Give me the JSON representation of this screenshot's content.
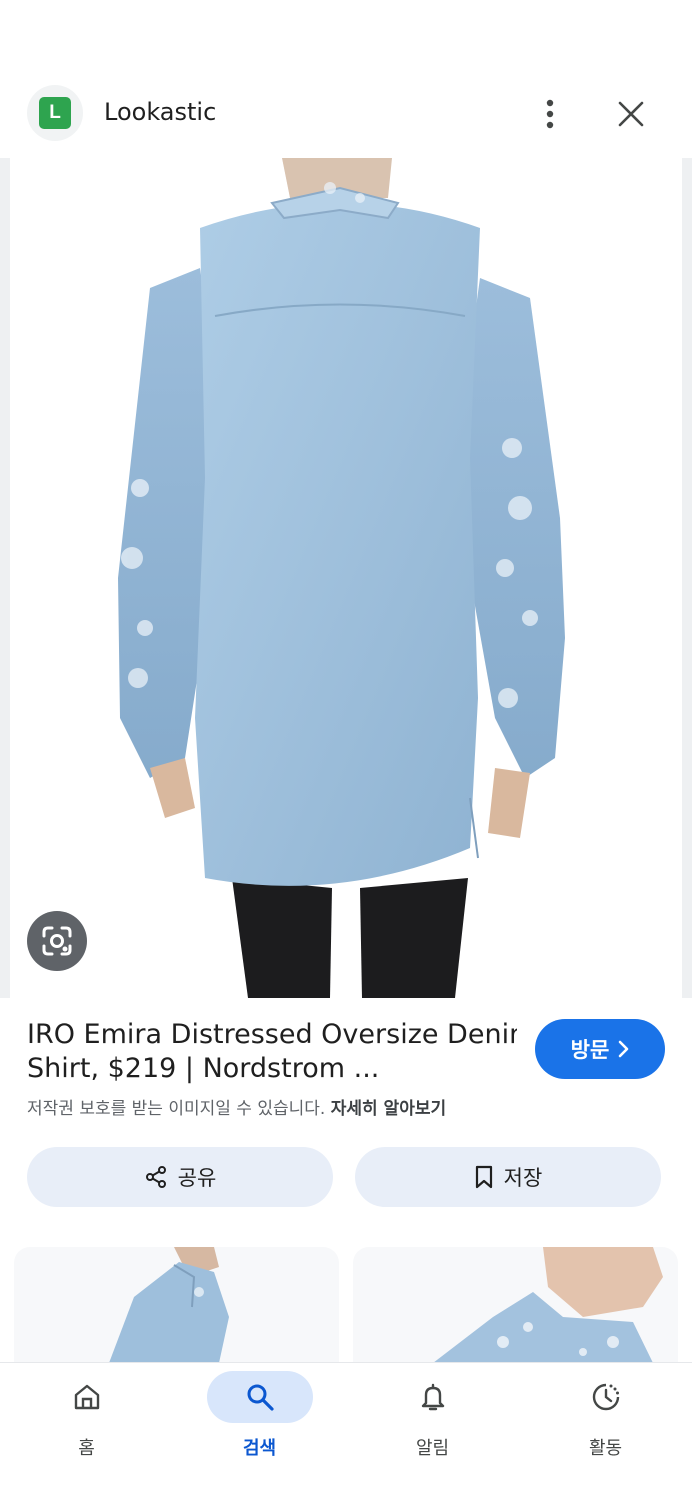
{
  "header": {
    "favicon_letter": "L",
    "site_name": "Lookastic",
    "icons": {
      "more": "more-vert-icon",
      "close": "close-icon"
    }
  },
  "result": {
    "title_line1": "IRO Emira Distressed Oversize Denim",
    "title_line2": "Shirt, $219 | Nordstrom ...",
    "visit_label": "방문",
    "notice_text": "저작권 보호를 받는 이미지일 수 있습니다.",
    "notice_link": "자세히 알아보기"
  },
  "actions": {
    "share_label": "공유",
    "save_label": "저장"
  },
  "bottom_nav": {
    "items": [
      {
        "label": "홈",
        "icon": "home-icon",
        "active": false
      },
      {
        "label": "검색",
        "icon": "search-icon",
        "active": true
      },
      {
        "label": "알림",
        "icon": "bell-icon",
        "active": false
      },
      {
        "label": "활동",
        "icon": "history-icon",
        "active": false
      }
    ]
  },
  "colors": {
    "accent": "#1a73e8",
    "favicon": "#2ea44f",
    "pill_bg": "#e8eef8",
    "nav_active_bg": "#d8e6fb"
  }
}
